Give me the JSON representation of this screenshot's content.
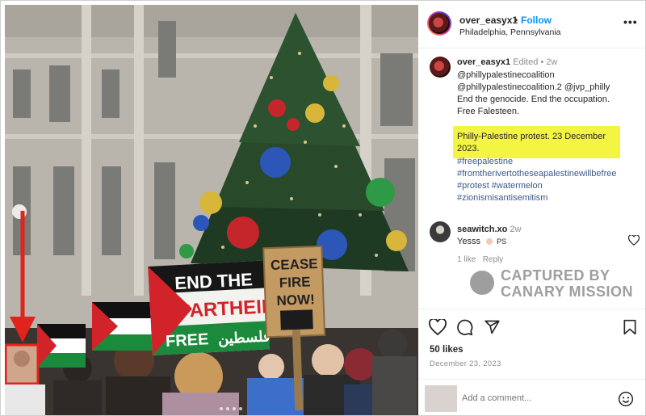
{
  "post": {
    "username": "over_easyx1",
    "separator": "•",
    "follow_label": "Follow",
    "location": "Philadelphia, Pennsylvania",
    "more_label": "•••"
  },
  "caption": {
    "username": "over_easyx1",
    "edited_label": "Edited",
    "separator": "•",
    "age": "2w",
    "mention_1": "@phillypalestinecoalition",
    "mention_2": "@phillypalestinecoalition.2",
    "mention_3": "@jvp_philly",
    "line_1": "End the genocide. End the occupation.",
    "line_2": "Free Falesteen.",
    "highlight_line_1": "Philly-Palestine protest. 23 December",
    "highlight_line_2": "2023.",
    "hashtags": [
      "#freepalestine",
      "#fromtherivertotheseapalestinewillbefree",
      "#protest #watermelon",
      "#zionismisantisemitism"
    ]
  },
  "comment": {
    "username": "seawitch.xo",
    "age": "2w",
    "text": "Yesss",
    "suffix": "PS",
    "likes_label": "1 like",
    "reply_label": "Reply"
  },
  "watermark": {
    "line_1": "CAPTURED BY",
    "line_2": "CANARY MISSION"
  },
  "stats": {
    "likes": "50 likes",
    "date": "December 23, 2023"
  },
  "add_comment": {
    "placeholder": "Add a comment..."
  },
  "photo": {
    "sign_1_line_1": "END THE",
    "sign_1_line_2": "APARTHEID",
    "sign_1_line_3": "FREE",
    "sign_1_arabic": "فلسطين",
    "sign_2_line_1": "CEASE",
    "sign_2_line_2": "FIRE",
    "sign_2_line_3": "NOW!"
  },
  "colors": {
    "follow": "#0095f6",
    "highlight": "#f4f442",
    "annotation": "#e0231c",
    "hashtag": "#3d5a8a"
  }
}
